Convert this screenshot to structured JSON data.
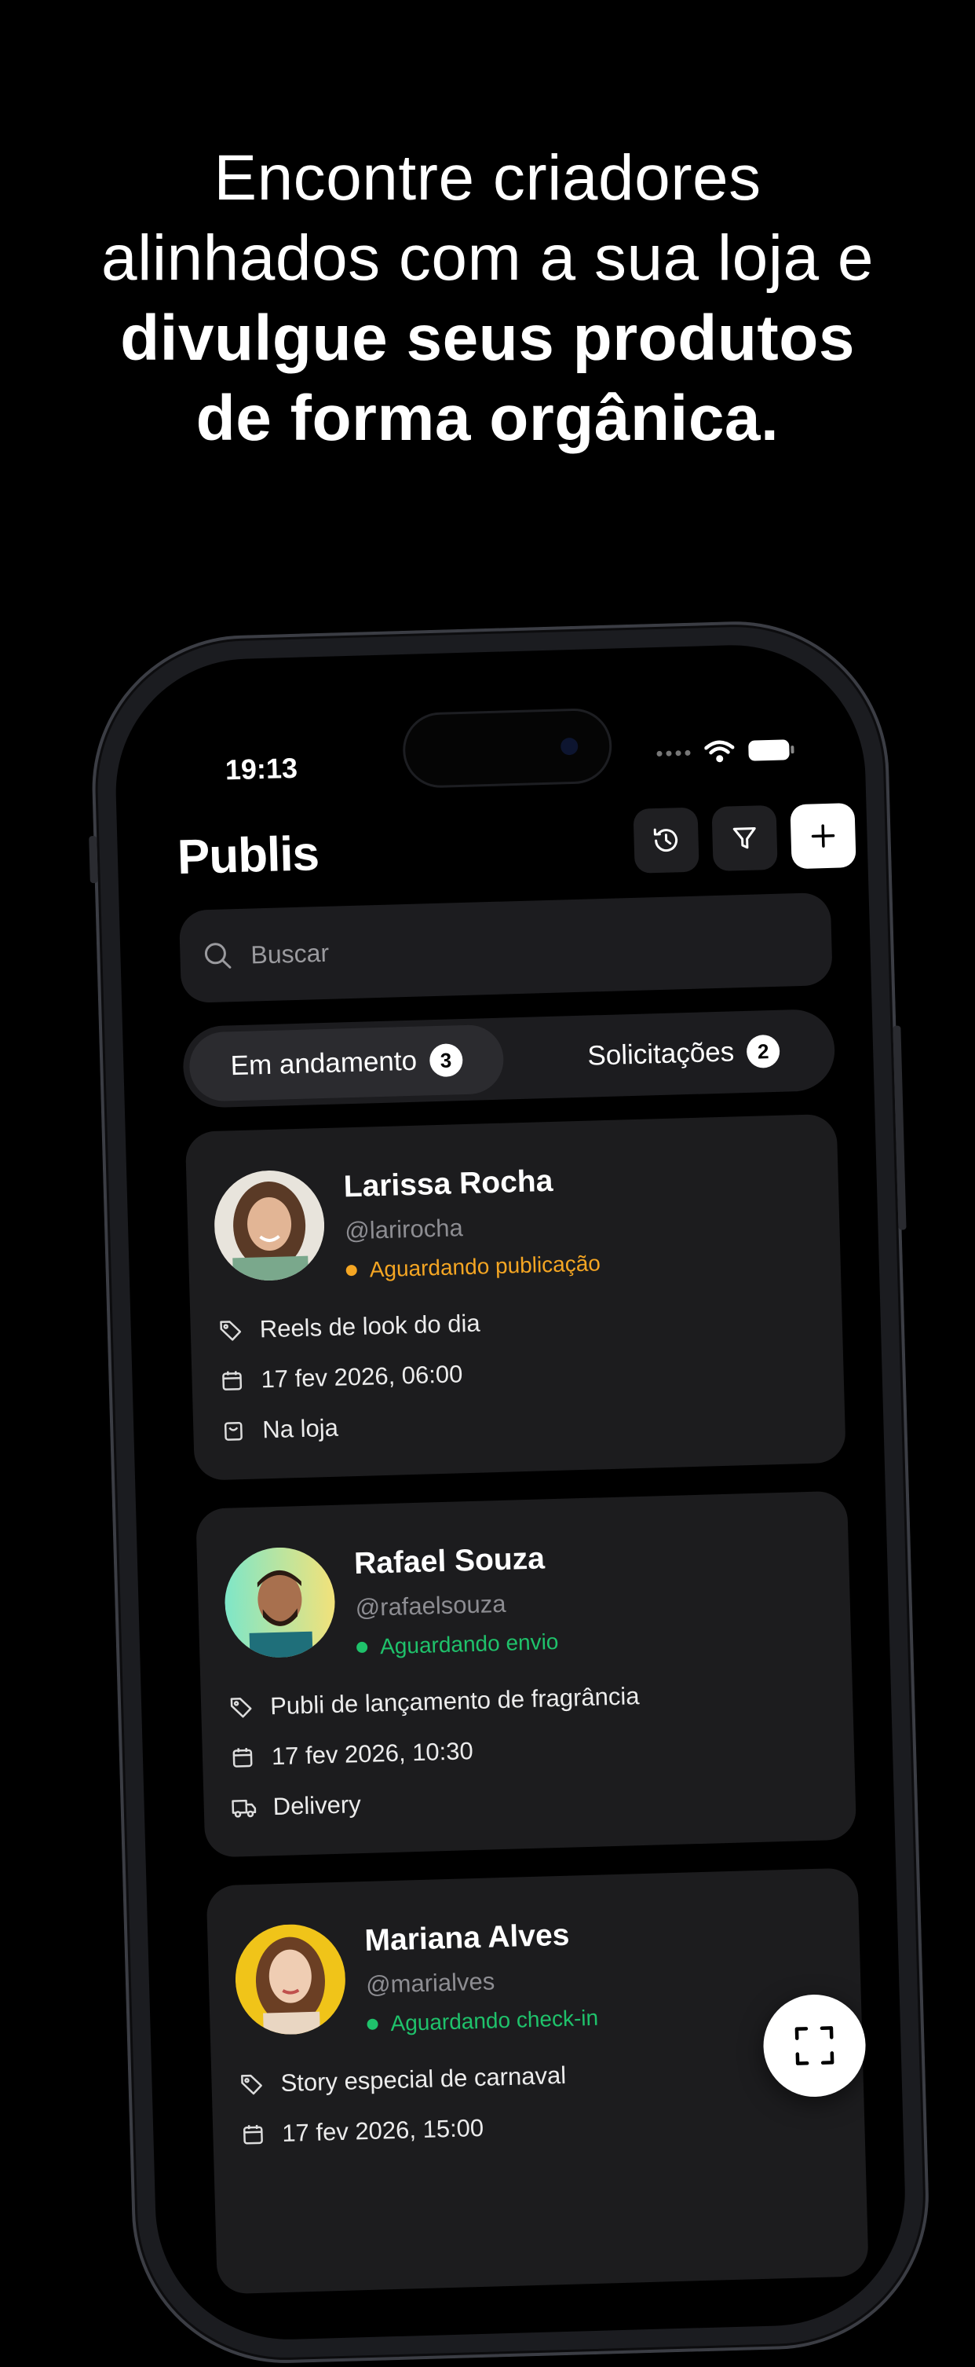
{
  "headline": {
    "line1": "Encontre criadores",
    "line2": "alinhados com a sua loja e",
    "line3": "divulgue seus produtos",
    "line4": "de forma orgânica."
  },
  "status_bar": {
    "time": "19:13"
  },
  "header": {
    "title": "Publis",
    "history_icon": "history-icon",
    "filter_icon": "filter-icon",
    "add_icon": "plus-icon"
  },
  "search": {
    "placeholder": "Buscar",
    "value": ""
  },
  "tabs": [
    {
      "label": "Em andamento",
      "count": "3",
      "active": true
    },
    {
      "label": "Solicitações",
      "count": "2",
      "active": false
    }
  ],
  "cards": [
    {
      "name": "Larissa Rocha",
      "handle": "@larirocha",
      "status": "Aguardando publicação",
      "status_color": "#f5a623",
      "title": "Reels de look do dia",
      "date": "17 fev 2026, 06:00",
      "mode": "Na loja",
      "mode_icon": "bag-icon"
    },
    {
      "name": "Rafael Souza",
      "handle": "@rafaelsouza",
      "status": "Aguardando envio",
      "status_color": "#1fc26b",
      "title": "Publi de lançamento de fragrância",
      "date": "17 fev 2026, 10:30",
      "mode": "Delivery",
      "mode_icon": "truck-icon"
    },
    {
      "name": "Mariana Alves",
      "handle": "@marialves",
      "status": "Aguardando check-in",
      "status_color": "#1fc26b",
      "title": "Story especial de carnaval",
      "date": "17 fev 2026, 15:00",
      "mode": "",
      "mode_icon": ""
    }
  ],
  "fab": {
    "icon": "scan-icon"
  }
}
